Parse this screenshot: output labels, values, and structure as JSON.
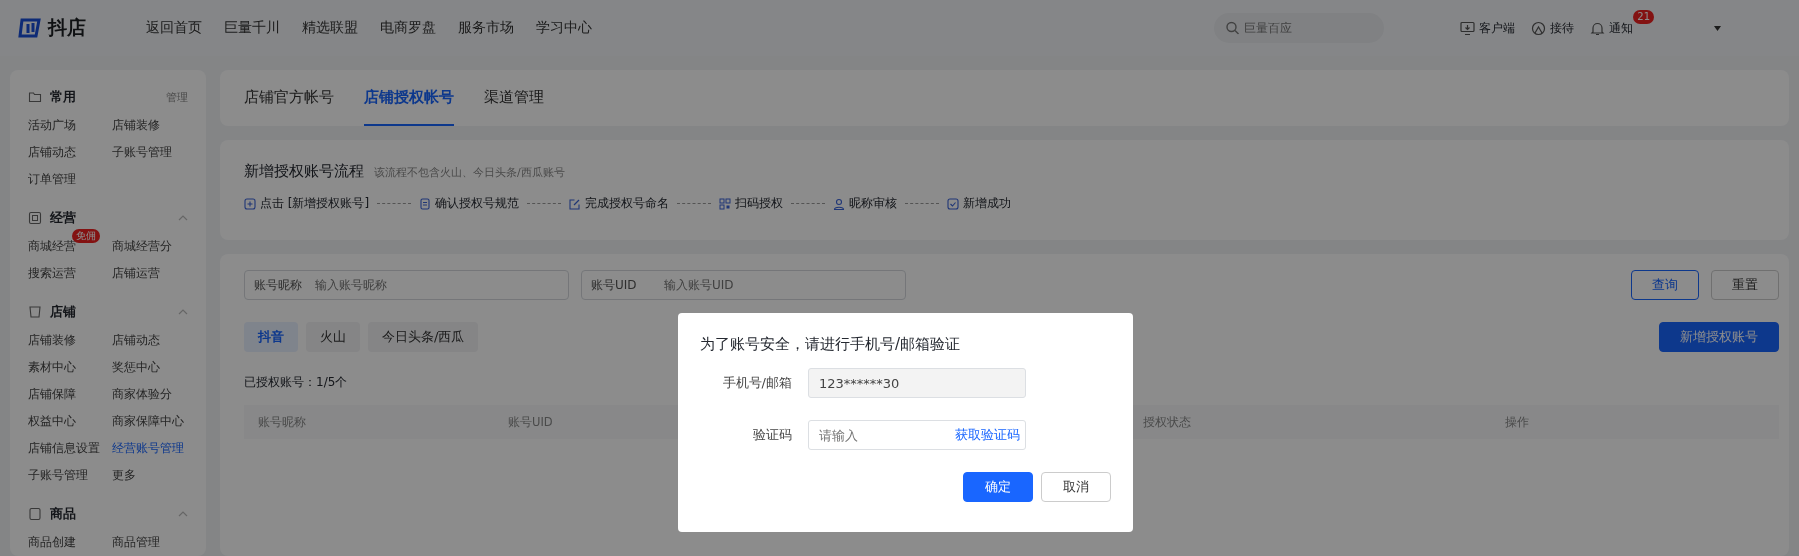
{
  "header": {
    "logo_text": "抖店",
    "nav": [
      {
        "label": "返回首页"
      },
      {
        "label": "巨量千川"
      },
      {
        "label": "精选联盟"
      },
      {
        "label": "电商罗盘"
      },
      {
        "label": "服务市场"
      },
      {
        "label": "学习中心"
      }
    ],
    "search": {
      "placeholder": "巨量百应"
    },
    "actions": [
      {
        "kind": "client",
        "label": "客户端"
      },
      {
        "kind": "reception",
        "label": "接待"
      },
      {
        "kind": "notice",
        "label": "通知",
        "badge": "21"
      }
    ]
  },
  "sidebar": {
    "sections": [
      {
        "title": "常用",
        "action": "管理",
        "items": [
          {
            "label": "活动广场",
            "selected": false
          },
          {
            "label": "店铺装修",
            "selected": false
          },
          {
            "label": "店铺动态",
            "selected": false
          },
          {
            "label": "子账号管理",
            "selected": false
          },
          {
            "label": "订单管理",
            "selected": false
          }
        ]
      },
      {
        "title": "经营",
        "expanded": true,
        "items": [
          {
            "label": "商城经营",
            "selected": false,
            "badge": "免佣"
          },
          {
            "label": "商城经营分",
            "selected": false
          },
          {
            "label": "搜索运营",
            "selected": false
          },
          {
            "label": "店铺运营",
            "selected": false
          }
        ]
      },
      {
        "title": "店铺",
        "expanded": true,
        "items": [
          {
            "label": "店铺装修",
            "selected": false
          },
          {
            "label": "店铺动态",
            "selected": false
          },
          {
            "label": "素材中心",
            "selected": false
          },
          {
            "label": "奖惩中心",
            "selected": false
          },
          {
            "label": "店铺保障",
            "selected": false
          },
          {
            "label": "商家体验分",
            "selected": false
          },
          {
            "label": "权益中心",
            "selected": false
          },
          {
            "label": "商家保障中心",
            "selected": false
          },
          {
            "label": "店铺信息设置",
            "selected": false
          },
          {
            "label": "经营账号管理",
            "selected": true
          },
          {
            "label": "子账号管理",
            "selected": false
          },
          {
            "label": "更多",
            "selected": false
          }
        ]
      },
      {
        "title": "商品",
        "expanded": true,
        "items": [
          {
            "label": "商品创建",
            "selected": false
          },
          {
            "label": "商品管理",
            "selected": false
          }
        ]
      }
    ]
  },
  "tabs": [
    {
      "label": "店铺官方帐号",
      "selected": false
    },
    {
      "label": "店铺授权帐号",
      "selected": true
    },
    {
      "label": "渠道管理",
      "selected": false
    }
  ],
  "process": {
    "title": "新增授权账号流程",
    "note": "该流程不包含火山、今日头条/西瓜账号",
    "steps": [
      {
        "kind": "plus",
        "label": "点击 [新增授权账号]"
      },
      {
        "kind": "doc",
        "label": "确认授权号规范"
      },
      {
        "kind": "edit",
        "label": "完成授权号命名"
      },
      {
        "kind": "qr",
        "label": "扫码授权"
      },
      {
        "kind": "user",
        "label": "昵称审核"
      },
      {
        "kind": "check",
        "label": "新增成功"
      }
    ]
  },
  "filters": {
    "fields": [
      {
        "label": "账号昵称",
        "placeholder": "输入账号昵称"
      },
      {
        "label": "账号UID",
        "placeholder": "输入账号UID"
      }
    ],
    "buttons": [
      {
        "kind": "primary",
        "label": "查询"
      },
      {
        "kind": "default",
        "label": "重置"
      }
    ]
  },
  "platform_tabs": [
    {
      "label": "抖音",
      "selected": true
    },
    {
      "label": "火山",
      "selected": false
    },
    {
      "label": "今日头条/西瓜",
      "selected": false
    }
  ],
  "add_button": "新增授权账号",
  "count_text": "已授权账号：1/5个",
  "table": {
    "columns": [
      "账号昵称",
      "账号UID",
      "授权状态",
      "操作"
    ]
  },
  "dialog": {
    "title": "为了账号安全，请进行手机号/邮箱验证",
    "fields": [
      {
        "label": "手机号/邮箱",
        "value": "123******30",
        "disabled": true
      },
      {
        "label": "验证码",
        "placeholder": "请输入",
        "action": "获取验证码",
        "disabled": false
      }
    ],
    "buttons": [
      {
        "kind": "primary",
        "label": "确定"
      },
      {
        "kind": "default",
        "label": "取消"
      }
    ]
  }
}
